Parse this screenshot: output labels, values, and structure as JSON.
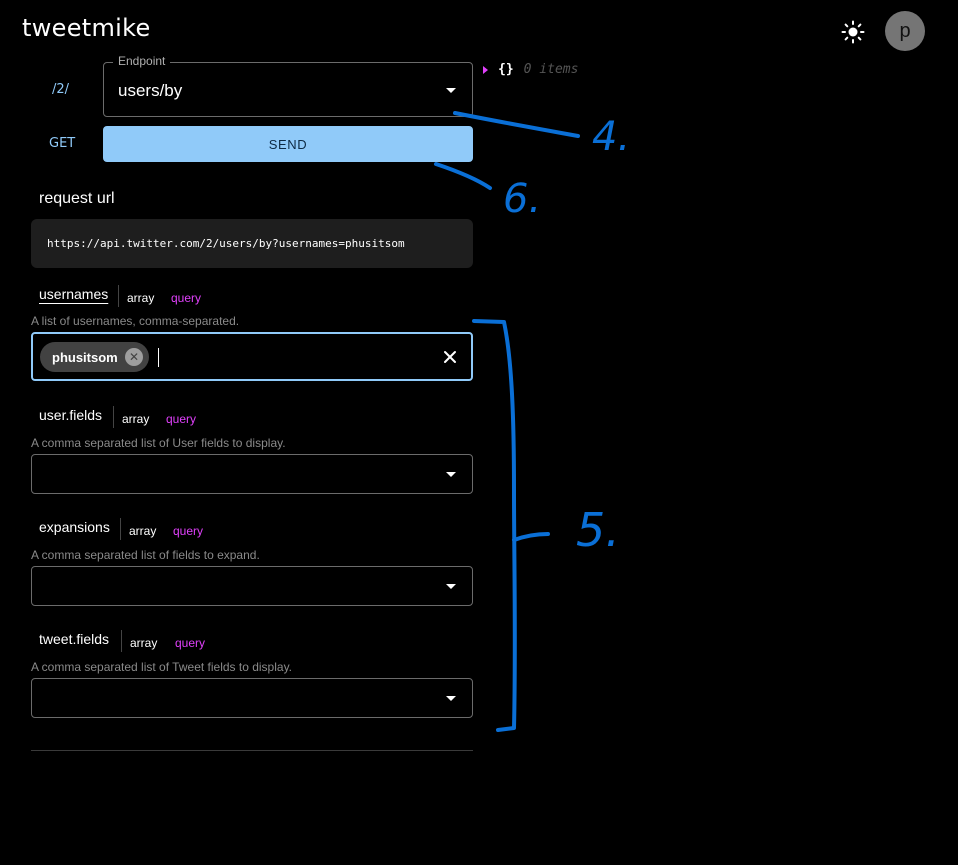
{
  "app": {
    "title": "tweetmike"
  },
  "header": {
    "theme_icon": "sun-icon",
    "avatar_letter": "p"
  },
  "endpoint": {
    "version": "/2/",
    "legend": "Endpoint",
    "value": "users/by",
    "method": "GET",
    "send_label": "SEND"
  },
  "json_viewer": {
    "braces": "{}",
    "count": "0 items"
  },
  "request_url": {
    "title": "request url",
    "url": "https://api.twitter.com/2/users/by?usernames=phusitsom"
  },
  "params": {
    "usernames": {
      "name": "usernames",
      "type": "array",
      "location": "query",
      "description": "A list of usernames, comma-separated.",
      "chips": [
        "phusitsom"
      ]
    },
    "user_fields": {
      "name": "user.fields",
      "type": "array",
      "location": "query",
      "description": "A comma separated list of User fields to display."
    },
    "expansions": {
      "name": "expansions",
      "type": "array",
      "location": "query",
      "description": "A comma separated list of fields to expand."
    },
    "tweet_fields": {
      "name": "tweet.fields",
      "type": "array",
      "location": "query",
      "description": "A comma separated list of Tweet fields to display."
    }
  },
  "annotations": {
    "label_4": "4.",
    "label_5": "5.",
    "label_6": "6.",
    "color": "#0a6fd6"
  },
  "colors": {
    "accent": "#90caf9",
    "query": "#e040fb",
    "background": "#000000"
  }
}
